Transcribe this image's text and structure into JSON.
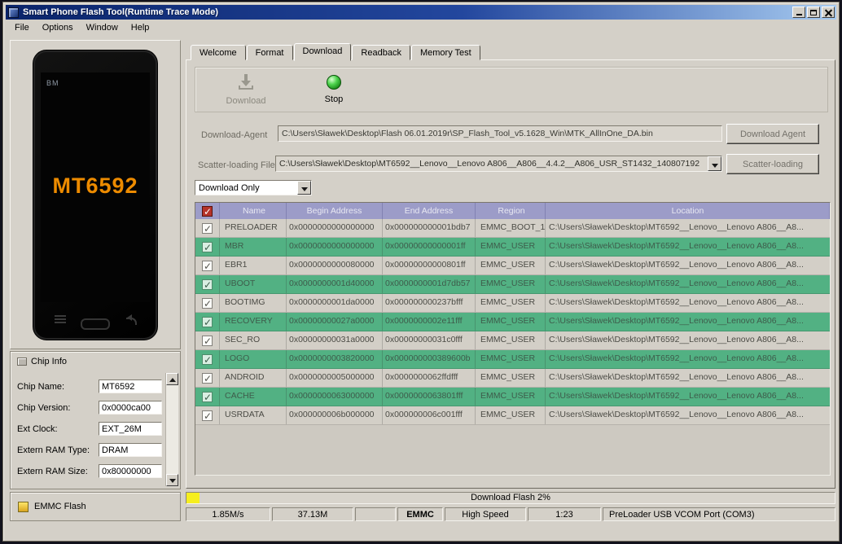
{
  "window": {
    "title": "Smart Phone Flash Tool(Runtime Trace Mode)",
    "menu_items": [
      "File",
      "Options",
      "Window",
      "Help"
    ]
  },
  "phone_preview": {
    "brand_label": "BM",
    "chip_label": "MT6592"
  },
  "chip_info": {
    "title": "Chip Info",
    "fields": [
      {
        "label": "Chip Name:",
        "value": "MT6592"
      },
      {
        "label": "Chip Version:",
        "value": "0x0000ca00"
      },
      {
        "label": "Ext Clock:",
        "value": "EXT_26M"
      },
      {
        "label": "Extern RAM Type:",
        "value": "DRAM"
      },
      {
        "label": "Extern RAM Size:",
        "value": "0x80000000"
      }
    ]
  },
  "emmc_flash": {
    "label": "EMMC Flash"
  },
  "tabs": [
    {
      "label": "Welcome",
      "active": false
    },
    {
      "label": "Format",
      "active": false
    },
    {
      "label": "Download",
      "active": true
    },
    {
      "label": "Readback",
      "active": false
    },
    {
      "label": "Memory Test",
      "active": false
    }
  ],
  "toolbar": {
    "download_label": "Download",
    "stop_label": "Stop"
  },
  "download_form": {
    "agent_label": "Download-Agent",
    "agent_path": "C:\\Users\\Sławek\\Desktop\\Flash 06.01.2019r\\SP_Flash_Tool_v5.1628_Win\\MTK_AllInOne_DA.bin",
    "agent_button": "Download Agent",
    "scatter_label": "Scatter-loading File",
    "scatter_path": "C:\\Users\\Sławek\\Desktop\\MT6592__Lenovo__Lenovo A806__A806__4.4.2__A806_USR_ST1432_140807192",
    "scatter_button": "Scatter-loading",
    "mode_selected": "Download Only"
  },
  "partition_table": {
    "headers": [
      "Name",
      "Begin Address",
      "End Address",
      "Region",
      "Location"
    ],
    "rows": [
      {
        "checked": true,
        "highlight": false,
        "name": "PRELOADER",
        "begin": "0x0000000000000000",
        "end": "0x000000000001bdb7",
        "region": "EMMC_BOOT_1",
        "location": "C:\\Users\\Sławek\\Desktop\\MT6592__Lenovo__Lenovo A806__A8..."
      },
      {
        "checked": true,
        "highlight": true,
        "name": "MBR",
        "begin": "0x0000000000000000",
        "end": "0x00000000000001ff",
        "region": "EMMC_USER",
        "location": "C:\\Users\\Sławek\\Desktop\\MT6592__Lenovo__Lenovo A806__A8..."
      },
      {
        "checked": true,
        "highlight": false,
        "name": "EBR1",
        "begin": "0x0000000000080000",
        "end": "0x00000000000801ff",
        "region": "EMMC_USER",
        "location": "C:\\Users\\Sławek\\Desktop\\MT6592__Lenovo__Lenovo A806__A8..."
      },
      {
        "checked": true,
        "highlight": true,
        "name": "UBOOT",
        "begin": "0x0000000001d40000",
        "end": "0x0000000001d7db57",
        "region": "EMMC_USER",
        "location": "C:\\Users\\Sławek\\Desktop\\MT6592__Lenovo__Lenovo A806__A8..."
      },
      {
        "checked": true,
        "highlight": false,
        "name": "BOOTIMG",
        "begin": "0x0000000001da0000",
        "end": "0x000000000237bfff",
        "region": "EMMC_USER",
        "location": "C:\\Users\\Sławek\\Desktop\\MT6592__Lenovo__Lenovo A806__A8..."
      },
      {
        "checked": true,
        "highlight": true,
        "name": "RECOVERY",
        "begin": "0x00000000027a0000",
        "end": "0x0000000002e11fff",
        "region": "EMMC_USER",
        "location": "C:\\Users\\Sławek\\Desktop\\MT6592__Lenovo__Lenovo A806__A8..."
      },
      {
        "checked": true,
        "highlight": false,
        "name": "SEC_RO",
        "begin": "0x00000000031a0000",
        "end": "0x00000000031c0fff",
        "region": "EMMC_USER",
        "location": "C:\\Users\\Sławek\\Desktop\\MT6592__Lenovo__Lenovo A806__A8..."
      },
      {
        "checked": true,
        "highlight": true,
        "name": "LOGO",
        "begin": "0x0000000003820000",
        "end": "0x000000000389600b",
        "region": "EMMC_USER",
        "location": "C:\\Users\\Sławek\\Desktop\\MT6592__Lenovo__Lenovo A806__A8..."
      },
      {
        "checked": true,
        "highlight": false,
        "name": "ANDROID",
        "begin": "0x0000000005000000",
        "end": "0x0000000062ffdfff",
        "region": "EMMC_USER",
        "location": "C:\\Users\\Sławek\\Desktop\\MT6592__Lenovo__Lenovo A806__A8..."
      },
      {
        "checked": true,
        "highlight": true,
        "name": "CACHE",
        "begin": "0x0000000063000000",
        "end": "0x0000000063801fff",
        "region": "EMMC_USER",
        "location": "C:\\Users\\Sławek\\Desktop\\MT6592__Lenovo__Lenovo A806__A8..."
      },
      {
        "checked": true,
        "highlight": false,
        "name": "USRDATA",
        "begin": "0x000000006b000000",
        "end": "0x000000006c001fff",
        "region": "EMMC_USER",
        "location": "C:\\Users\\Sławek\\Desktop\\MT6592__Lenovo__Lenovo A806__A8..."
      }
    ]
  },
  "progress": {
    "label": "Download Flash 2%",
    "percent": 2
  },
  "status_bar": {
    "speed": "1.85M/s",
    "transferred": "37.13M",
    "spare": "",
    "storage": "EMMC",
    "usb_mode": "High Speed",
    "elapsed": "1:23",
    "port": "PreLoader USB VCOM Port (COM3)"
  },
  "colors": {
    "row_highlight": "#52b183",
    "table_header_bg": "#9c9cc8",
    "progress_fill": "#f6ee1e",
    "phone_text": "#ed8b00",
    "titlebar_start": "#0a246a",
    "titlebar_end": "#a6caf0"
  }
}
